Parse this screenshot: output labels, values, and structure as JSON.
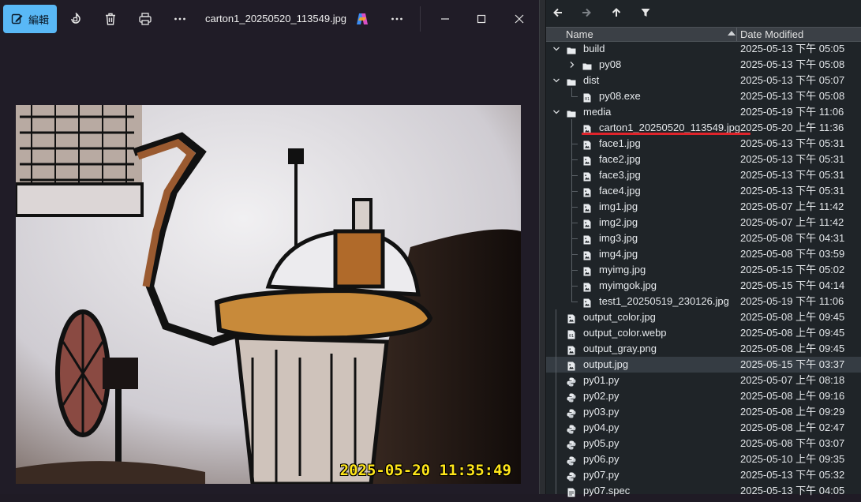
{
  "viewer": {
    "edit_label": "編輯",
    "file_name": "carton1_20250520_113549.jpg",
    "photo_timestamp": "2025-05-20 11:35:49"
  },
  "explorer": {
    "columns": {
      "name": "Name",
      "date": "Date Modified"
    },
    "rows": [
      {
        "name": "build",
        "date": "2025-05-13 下午 05:05",
        "type": "folder",
        "level": 0,
        "twisty": "expanded"
      },
      {
        "name": "py08",
        "date": "2025-05-13 下午 05:08",
        "type": "folder",
        "level": 1,
        "twisty": "collapsed"
      },
      {
        "name": "dist",
        "date": "2025-05-13 下午 05:07",
        "type": "folder",
        "level": 0,
        "twisty": "expanded"
      },
      {
        "name": "py08.exe",
        "date": "2025-05-13 下午 05:08",
        "type": "exe",
        "level": 1,
        "twisty": "none"
      },
      {
        "name": "media",
        "date": "2025-05-19 下午 11:06",
        "type": "folder",
        "level": 0,
        "twisty": "expanded"
      },
      {
        "name": "carton1_20250520_113549.jpg",
        "date": "2025-05-20 上午 11:36",
        "type": "image",
        "level": 1,
        "twisty": "none",
        "highlight": true
      },
      {
        "name": "face1.jpg",
        "date": "2025-05-13 下午 05:31",
        "type": "image",
        "level": 1,
        "twisty": "none"
      },
      {
        "name": "face2.jpg",
        "date": "2025-05-13 下午 05:31",
        "type": "image",
        "level": 1,
        "twisty": "none"
      },
      {
        "name": "face3.jpg",
        "date": "2025-05-13 下午 05:31",
        "type": "image",
        "level": 1,
        "twisty": "none"
      },
      {
        "name": "face4.jpg",
        "date": "2025-05-13 下午 05:31",
        "type": "image",
        "level": 1,
        "twisty": "none"
      },
      {
        "name": "img1.jpg",
        "date": "2025-05-07 上午 11:42",
        "type": "image",
        "level": 1,
        "twisty": "none"
      },
      {
        "name": "img2.jpg",
        "date": "2025-05-07 上午 11:42",
        "type": "image",
        "level": 1,
        "twisty": "none"
      },
      {
        "name": "img3.jpg",
        "date": "2025-05-08 下午 04:31",
        "type": "image",
        "level": 1,
        "twisty": "none"
      },
      {
        "name": "img4.jpg",
        "date": "2025-05-08 下午 03:59",
        "type": "image",
        "level": 1,
        "twisty": "none"
      },
      {
        "name": "myimg.jpg",
        "date": "2025-05-15 下午 05:02",
        "type": "image",
        "level": 1,
        "twisty": "none"
      },
      {
        "name": "myimgok.jpg",
        "date": "2025-05-15 下午 04:14",
        "type": "image",
        "level": 1,
        "twisty": "none"
      },
      {
        "name": "test1_20250519_230126.jpg",
        "date": "2025-05-19 下午 11:06",
        "type": "image",
        "level": 1,
        "twisty": "none",
        "last": true
      },
      {
        "name": "output_color.jpg",
        "date": "2025-05-08 上午 09:45",
        "type": "image",
        "level": 0,
        "twisty": "none"
      },
      {
        "name": "output_color.webp",
        "date": "2025-05-08 上午 09:45",
        "type": "exe",
        "level": 0,
        "twisty": "none"
      },
      {
        "name": "output_gray.png",
        "date": "2025-05-08 上午 09:45",
        "type": "image",
        "level": 0,
        "twisty": "none"
      },
      {
        "name": "output.jpg",
        "date": "2025-05-15 下午 03:37",
        "type": "image",
        "level": 0,
        "twisty": "none",
        "selected": true
      },
      {
        "name": "py01.py",
        "date": "2025-05-07 上午 08:18",
        "type": "python",
        "level": 0,
        "twisty": "none"
      },
      {
        "name": "py02.py",
        "date": "2025-05-08 上午 09:16",
        "type": "python",
        "level": 0,
        "twisty": "none"
      },
      {
        "name": "py03.py",
        "date": "2025-05-08 上午 09:29",
        "type": "python",
        "level": 0,
        "twisty": "none"
      },
      {
        "name": "py04.py",
        "date": "2025-05-08 上午 02:47",
        "type": "python",
        "level": 0,
        "twisty": "none"
      },
      {
        "name": "py05.py",
        "date": "2025-05-08 下午 03:07",
        "type": "python",
        "level": 0,
        "twisty": "none"
      },
      {
        "name": "py06.py",
        "date": "2025-05-10 上午 09:35",
        "type": "python",
        "level": 0,
        "twisty": "none"
      },
      {
        "name": "py07.py",
        "date": "2025-05-13 下午 05:32",
        "type": "python",
        "level": 0,
        "twisty": "none"
      },
      {
        "name": "py07.spec",
        "date": "2025-05-13 下午 04:05",
        "type": "file",
        "level": 0,
        "twisty": "none"
      }
    ]
  }
}
